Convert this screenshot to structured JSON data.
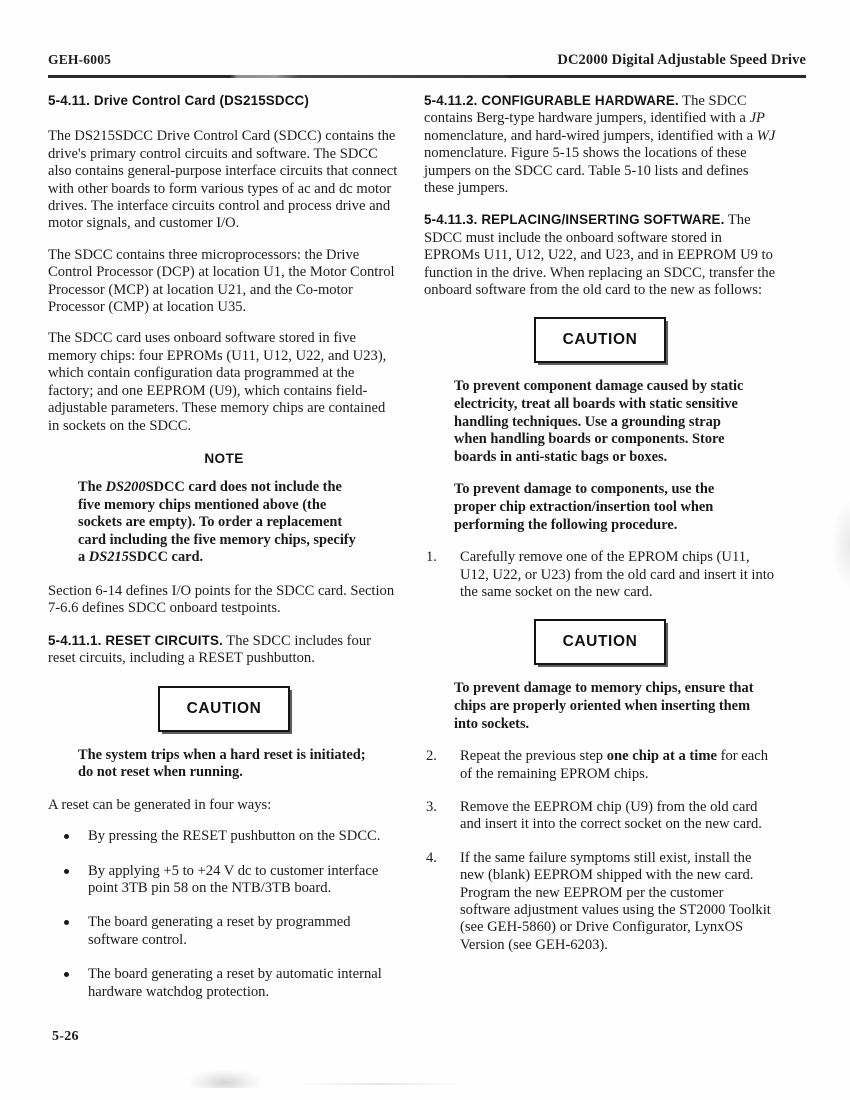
{
  "header": {
    "left": "GEH-6005",
    "right": "DC2000 Digital Adjustable Speed Drive"
  },
  "folio": "5-26",
  "left_column": {
    "section_title": "5-4.11. Drive Control Card (DS215SDCC)",
    "para1": "The DS215SDCC Drive Control Card (SDCC) contains the drive's primary control circuits and software. The SDCC also contains general-purpose interface circuits that connect with other boards to form various types of ac and dc motor drives. The interface circuits control and process drive and motor signals, and customer I/O.",
    "para2": "The SDCC contains three microprocessors: the Drive Control Processor (DCP) at location U1, the Motor Control Processor (MCP) at location U21, and the Co-motor Processor (CMP) at location U35.",
    "para3": "The SDCC card uses onboard software stored in five memory chips: four EPROMs (U11, U12, U22, and U23), which contain configuration data programmed at the factory; and one EEPROM (U9), which contains field-adjustable parameters. These memory chips are contained in sockets on the SDCC.",
    "note_title": "NOTE",
    "note_body_part1": "The ",
    "note_body_italic1": "DS200",
    "note_body_part2": "SDCC card does not include the five memory chips mentioned above (the sockets are empty). To order a replacement card including the five memory chips, specify a ",
    "note_body_italic2": "DS215",
    "note_body_part3": "SDCC card.",
    "para4": "Section 6-14 defines I/O points for the SDCC card. Section 7-6.6 defines SDCC onboard testpoints.",
    "subsection1_head": "5-4.11.1. RESET CIRCUITS.",
    "subsection1_body": " The SDCC includes four reset circuits, including a RESET pushbutton.",
    "caution_label": "CAUTION",
    "caution1_text": "The system trips when a hard reset is initiated; do not reset when running.",
    "para5": "A reset can be generated in four ways:",
    "bullets": [
      "By pressing the RESET pushbutton on the SDCC.",
      "By applying +5 to +24 V dc to customer interface point 3TB pin 58 on the NTB/3TB board.",
      "The board generating a reset by programmed software control.",
      "The board generating a reset by automatic internal hardware watchdog protection."
    ]
  },
  "right_column": {
    "subsection2_head": "5-4.11.2. CONFIGURABLE HARDWARE.",
    "subsection2_part1": " The SDCC contains Berg-type hardware jumpers, identified with a ",
    "subsection2_italic1": "JP",
    "subsection2_part2": " nomenclature, and hard-wired jumpers, identified with a ",
    "subsection2_italic2": "WJ",
    "subsection2_part3": " nomenclature. Figure 5-15 shows the locations of these jumpers on the SDCC card. Table 5-10 lists and defines these jumpers.",
    "subsection3_head": "5-4.11.3. REPLACING/INSERTING SOFTWARE.",
    "subsection3_body": " The SDCC must include the onboard software stored in EPROMs U11, U12, U22, and U23, and in EEPROM U9 to function in the drive. When replacing an SDCC, transfer the onboard software from the old card to the new as follows:",
    "caution_label": "CAUTION",
    "caution2_text1": "To prevent component damage caused by static electricity, treat all boards with static sensitive handling techniques. Use a grounding strap when handling boards or components. Store boards in anti-static bags or boxes.",
    "caution2_text2": "To prevent damage to components, use the proper chip extraction/insertion tool when performing the following procedure.",
    "step1_num": "1.",
    "step1_text": "Carefully remove one of the EPROM chips (U11, U12, U22, or U23) from the old card and insert it into the same socket on the new card.",
    "caution3_text": "To prevent damage to memory chips, ensure that chips are properly oriented when inserting them into sockets.",
    "step2_num": "2.",
    "step2_part1": "Repeat the previous step ",
    "step2_bold": "one chip at a time",
    "step2_part2": " for each of the remaining EPROM chips.",
    "step3_num": "3.",
    "step3_text": "Remove the EEPROM chip (U9) from the old card and insert it into the correct socket on the new card.",
    "step4_num": "4.",
    "step4_text": "If the same failure symptoms still exist, install the new (blank) EEPROM shipped with the new card. Program the new EEPROM per the customer software adjustment values using the ST2000 Toolkit (see GEH-5860) or Drive Configurator, LynxOS Version (see GEH-6203)."
  }
}
